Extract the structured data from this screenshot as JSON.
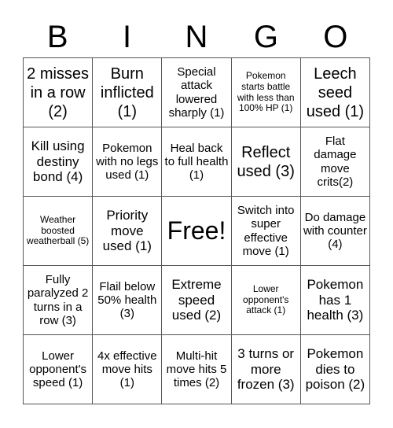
{
  "header": {
    "letters": [
      "B",
      "I",
      "N",
      "G",
      "O"
    ]
  },
  "board": {
    "rows": [
      [
        {
          "text": "2 misses in a row (2)",
          "size": "lg"
        },
        {
          "text": "Burn inflicted (1)",
          "size": "lg"
        },
        {
          "text": "Special attack lowered sharply (1)",
          "size": "sm"
        },
        {
          "text": "Pokemon starts battle with less than 100% HP (1)",
          "size": "xs"
        },
        {
          "text": "Leech seed used (1)",
          "size": "lg"
        }
      ],
      [
        {
          "text": "Kill using destiny bond (4)",
          "size": "md"
        },
        {
          "text": "Pokemon with no legs used (1)",
          "size": "sm"
        },
        {
          "text": "Heal back to full health (1)",
          "size": "sm"
        },
        {
          "text": "Reflect used (3)",
          "size": "lg"
        },
        {
          "text": "Flat damage move crits(2)",
          "size": "sm"
        }
      ],
      [
        {
          "text": "Weather boosted weatherball (5)",
          "size": "xs"
        },
        {
          "text": "Priority move used (1)",
          "size": "md"
        },
        {
          "text": "Free!",
          "size": "free"
        },
        {
          "text": "Switch into super effective move (1)",
          "size": "sm"
        },
        {
          "text": "Do damage with counter (4)",
          "size": "sm"
        }
      ],
      [
        {
          "text": "Fully paralyzed 2 turns in a row (3)",
          "size": "sm"
        },
        {
          "text": "Flail below 50% health (3)",
          "size": "sm"
        },
        {
          "text": "Extreme speed used (2)",
          "size": "md"
        },
        {
          "text": "Lower opponent's attack (1)",
          "size": "xs"
        },
        {
          "text": "Pokemon has 1 health (3)",
          "size": "md"
        }
      ],
      [
        {
          "text": "Lower opponent's speed (1)",
          "size": "sm"
        },
        {
          "text": "4x effective move hits (1)",
          "size": "sm"
        },
        {
          "text": "Multi-hit move hits 5 times (2)",
          "size": "sm"
        },
        {
          "text": "3 turns or more frozen (3)",
          "size": "md"
        },
        {
          "text": "Pokemon dies to poison (2)",
          "size": "md"
        }
      ]
    ]
  }
}
